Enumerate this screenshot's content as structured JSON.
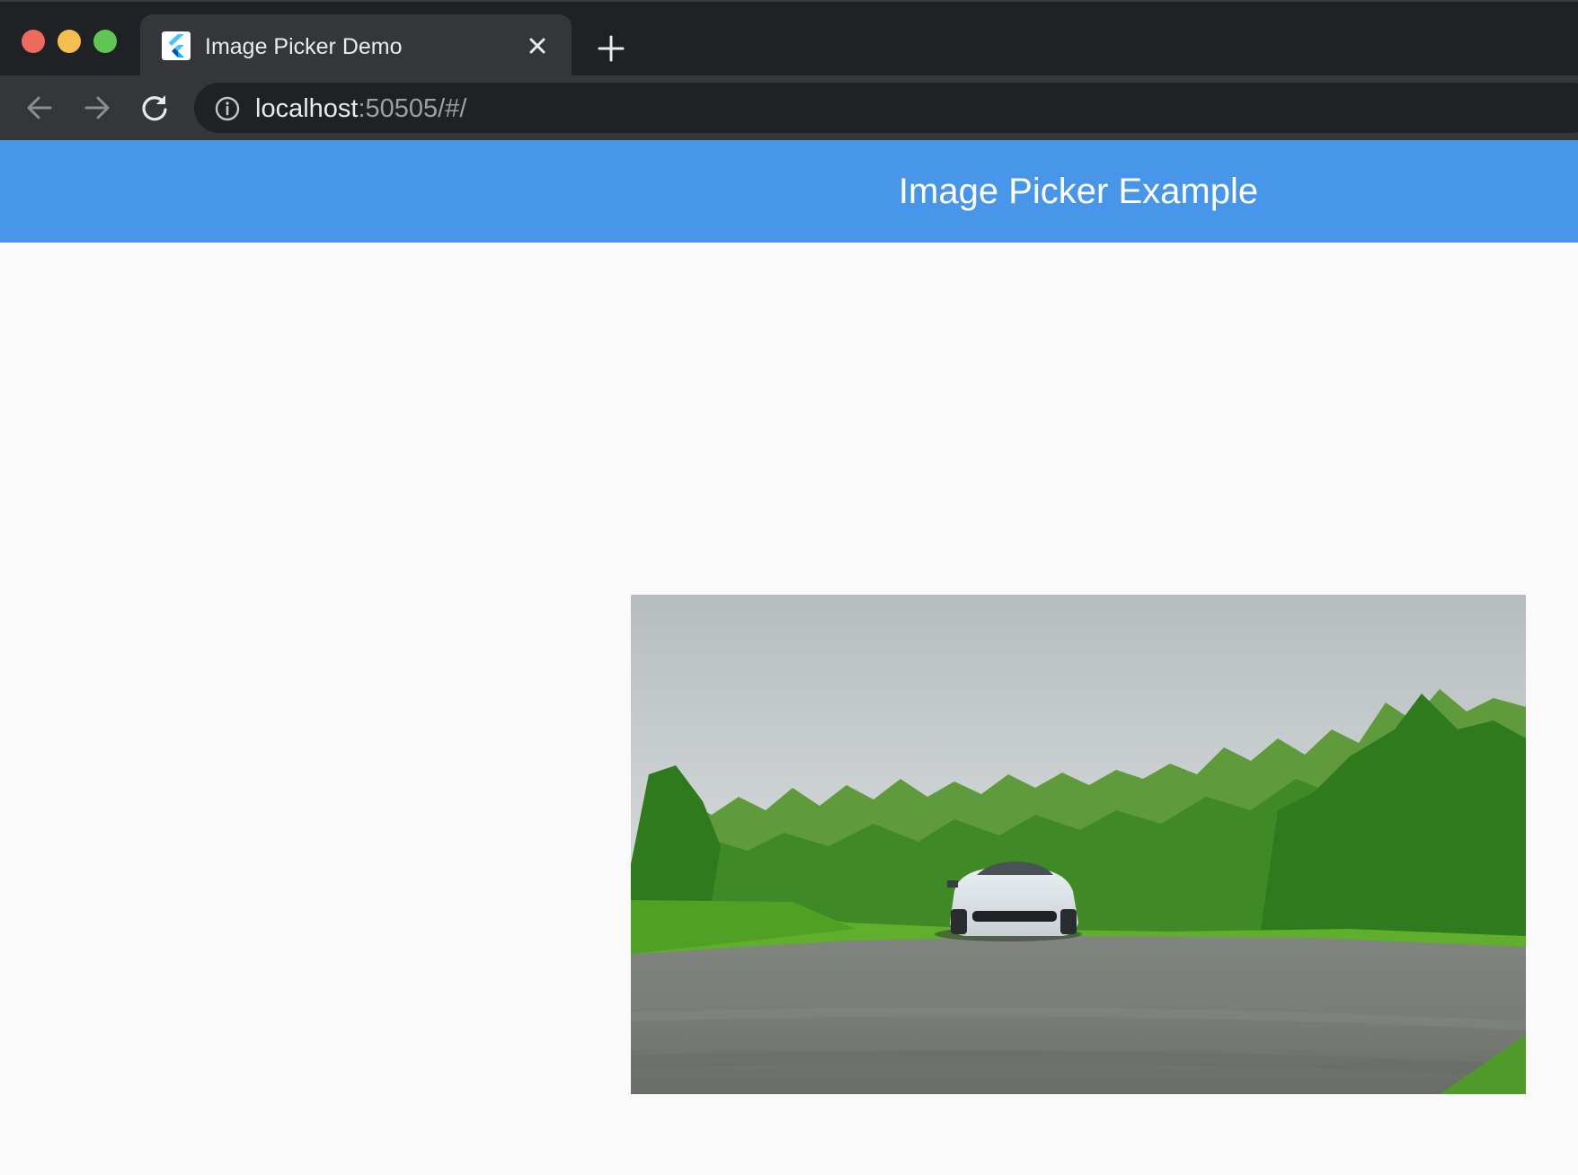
{
  "browser": {
    "tab": {
      "title": "Image Picker Demo",
      "favicon": "flutter-logo-icon",
      "close_icon": "close-icon"
    },
    "new_tab_icon": "plus-icon",
    "nav": {
      "back_icon": "arrow-left-icon",
      "forward_icon": "arrow-right-icon",
      "reload_icon": "reload-icon"
    },
    "address_bar": {
      "info_icon": "info-icon",
      "url_host": "localhost",
      "url_rest": ":50505/#/"
    },
    "colors": {
      "titlebar": "#202124",
      "toolbar": "#35363a",
      "close_dot": "#ed6a5e",
      "minimize_dot": "#f4bf4f",
      "maximize_dot": "#61c554"
    }
  },
  "app": {
    "appbar": {
      "title": "Image Picker Example",
      "color": "#4796ea"
    },
    "picked_image": {
      "subject": "white sports car on road with trees"
    }
  }
}
